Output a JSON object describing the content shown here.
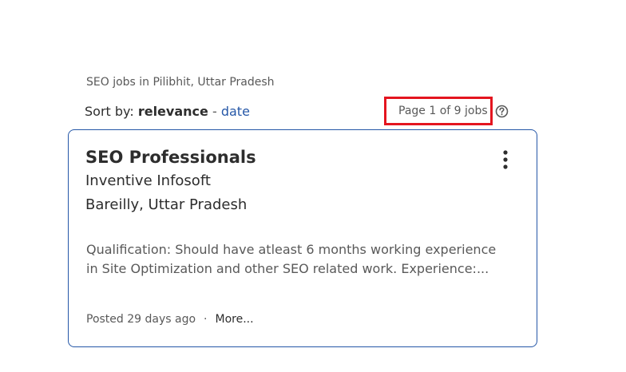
{
  "search": {
    "heading": "SEO jobs in Pilibhit, Uttar Pradesh"
  },
  "sort": {
    "label": "Sort by:",
    "active": "relevance",
    "separator": "-",
    "alternative": "date"
  },
  "pagination": {
    "text": "Page 1 of 9 jobs",
    "highlight_color": "#e4151f"
  },
  "job": {
    "title": "SEO Professionals",
    "company": "Inventive Infosoft",
    "location": "Bareilly, Uttar Pradesh",
    "snippet": "Qualification: Should have atleast 6 months working experience in Site Optimization and other SEO related work. Experience:...",
    "posted": "Posted 29 days ago",
    "dot": "·",
    "more": "More..."
  },
  "icons": {
    "help": "question-circle-icon",
    "menu": "vertical-dots-icon"
  },
  "colors": {
    "link": "#2557a7",
    "card_border": "#2557a7",
    "text": "#2d2d2d",
    "muted": "#595959"
  }
}
